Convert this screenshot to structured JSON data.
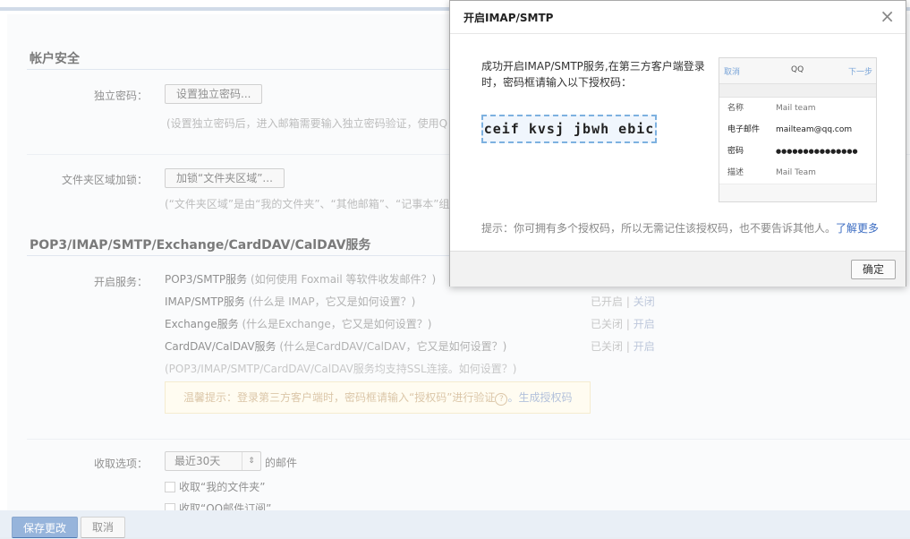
{
  "security": {
    "title": "帐户安全",
    "password_label": "独立密码：",
    "password_button": "设置独立密码...",
    "password_hint": "(设置独立密码后，进入邮箱需要输入独立密码验证，使用Q",
    "folder_label": "文件夹区域加锁：",
    "folder_button": "加锁“文件夹区域”...",
    "folder_hint": "(“文件夹区域”是由“我的文件夹”、“其他邮箱”、“记事本”组"
  },
  "services": {
    "title": "POP3/IMAP/SMTP/Exchange/CardDAV/CalDAV服务",
    "label": "开启服务：",
    "items": [
      {
        "name": "POP3/SMTP服务",
        "note": "(如何使用 Foxmail 等软件收发邮件？)"
      },
      {
        "name": "IMAP/SMTP服务",
        "note": "(什么是 IMAP，它又是如何设置？)",
        "status": "已开启",
        "sep": "|",
        "action": "关闭"
      },
      {
        "name": "Exchange服务",
        "note": "(什么是Exchange，它又是如何设置？)",
        "status": "已关闭",
        "sep": "|",
        "action": "开启"
      },
      {
        "name": "CardDAV/CalDAV服务",
        "note": "(什么是CardDAV/CalDAV，它又是如何设置？)",
        "status": "已关闭",
        "sep": "|",
        "action": "开启"
      }
    ],
    "ssl_note": "(POP3/IMAP/SMTP/CardDAV/CalDAV服务均支持SSL连接。如何设置？)",
    "tip_text": "温馨提示：登录第三方客户端时，密码框请输入“授权码”进行验证",
    "tip_help": "?",
    "tip_link": "。生成授权码"
  },
  "receive": {
    "label": "收取选项：",
    "select_value": "最近30天",
    "suffix": "的邮件",
    "check1": "收取“我的文件夹”",
    "check2": "收取“QQ邮件订阅”"
  },
  "footer": {
    "save": "保存更改",
    "cancel": "取消"
  },
  "modal": {
    "title": "开启IMAP/SMTP",
    "close": "×",
    "message": "成功开启IMAP/SMTP服务,在第三方客户端登录时，密码框请输入以下授权码：",
    "code": "ceif kvsj jbwh ebic",
    "phone": {
      "cancel": "取消",
      "title": "QQ",
      "next": "下一步",
      "rows": [
        {
          "k": "名称",
          "v": "Mail team"
        },
        {
          "k": "电子邮件",
          "v": "mailteam@qq.com"
        },
        {
          "k": "密码",
          "v": "●●●●●●●●●●●●●●●"
        },
        {
          "k": "描述",
          "v": "Mail Team"
        }
      ]
    },
    "tip": "提示：你可拥有多个授权码，所以无需记住该授权码，也不要告诉其他人。",
    "tip_link": "了解更多",
    "ok": "确定"
  }
}
